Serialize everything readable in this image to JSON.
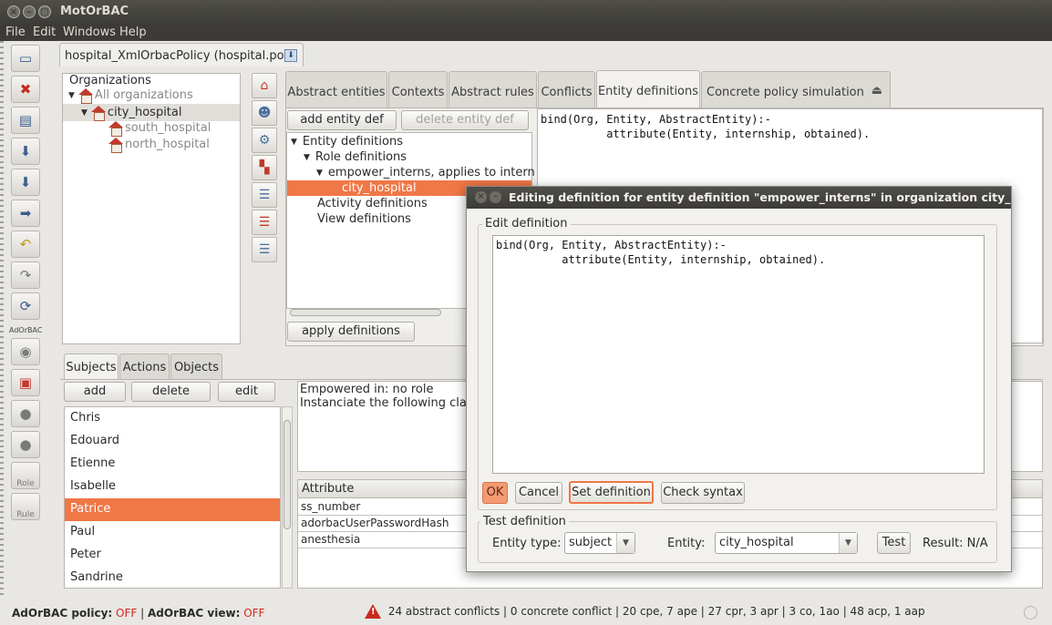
{
  "window": {
    "title": "MotOrBAC"
  },
  "menu": [
    "File",
    "Edit",
    "Windows",
    "Help"
  ],
  "toolbar": {
    "adorbac_label": "AdOrBAC",
    "role_label": "Role",
    "rule_label": "Rule"
  },
  "document_tab": "hospital_XmlOrbacPolicy (hospital.pof)",
  "organizations": {
    "header": "Organizations",
    "items": [
      "All organizations",
      "city_hospital",
      "south_hospital",
      "north_hospital"
    ]
  },
  "main_tabs": [
    "Abstract entities",
    "Contexts",
    "Abstract rules",
    "Conflicts",
    "Entity definitions",
    "Concrete policy simulation"
  ],
  "entity_defs": {
    "add_button": "add entity def",
    "delete_button": "delete entity def",
    "apply_button": "apply definitions",
    "tree": [
      "Entity definitions",
      "Role definitions",
      "empower_interns, applies to intern (c",
      "city_hospital",
      "Activity definitions",
      "View definitions"
    ],
    "code_line1": "bind(Org, Entity, AbstractEntity):-",
    "code_line2": "          attribute(Entity, internship, obtained)."
  },
  "lower_tabs": [
    "Subjects",
    "Actions",
    "Objects"
  ],
  "subject_buttons": {
    "add": "add",
    "delete": "delete",
    "edit": "edit"
  },
  "subjects": [
    "Chris",
    "Edouard",
    "Etienne",
    "Isabelle",
    "Patrice",
    "Paul",
    "Peter",
    "Sandrine"
  ],
  "selected_subject": "Patrice",
  "info": {
    "line1": "Empowered in:  no role",
    "line2": "Instanciate the following class"
  },
  "attributes": {
    "header": "Attribute",
    "rows": [
      "ss_number",
      "adorbacUserPasswordHash",
      "anesthesia"
    ]
  },
  "status": {
    "policy_label": "AdOrBAC policy:",
    "policy_value": "OFF",
    "view_label": "AdOrBAC view:",
    "view_value": "OFF",
    "separator": "|",
    "conflicts": "24 abstract conflicts | 0 concrete conflict | 20 cpe, 7 ape | 27 cpr, 3 apr | 3 co, 1ao | 48 acp, 1 aap"
  },
  "dialog": {
    "title": "Editing definition for entity definition \"empower_interns\" in organization city_hospital",
    "edit_legend": "Edit definition",
    "code_line1": "bind(Org, Entity, AbstractEntity):-",
    "code_line2": "          attribute(Entity, internship, obtained).",
    "ok": "OK",
    "cancel": "Cancel",
    "set_definition": "Set definition",
    "check_syntax": "Check syntax",
    "test_legend": "Test definition",
    "entity_type_label": "Entity type:",
    "entity_type_value": "subject",
    "entity_label": "Entity:",
    "entity_value": "city_hospital",
    "test_button": "Test",
    "result": "Result: N/A"
  },
  "colors": {
    "selection": "#f07746",
    "titlebar": "#3c3b37",
    "off": "#d3261b"
  }
}
